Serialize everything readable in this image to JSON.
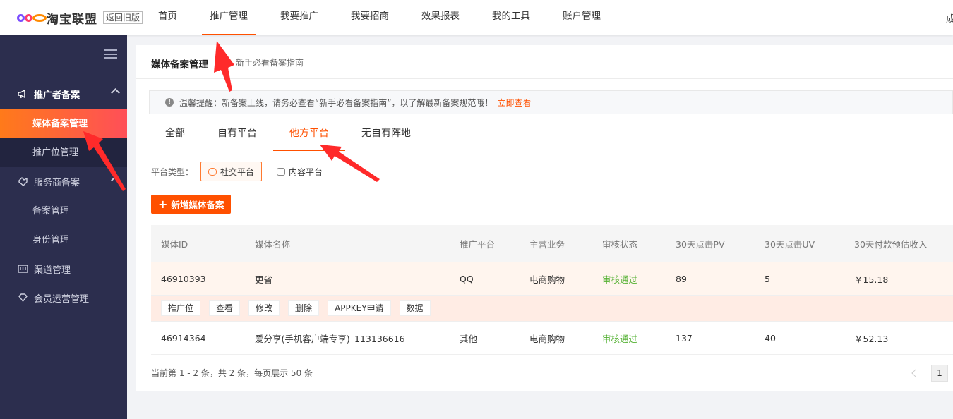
{
  "brand": {
    "name": "淘宝联盟",
    "old_version": "返回旧版"
  },
  "nav": {
    "items": [
      "首页",
      "推广管理",
      "我要推广",
      "我要招商",
      "效果报表",
      "我的工具",
      "账户管理"
    ],
    "active": "推广管理",
    "user": "成"
  },
  "sidebar": {
    "group1": "推广者备案",
    "group1_items": [
      "媒体备案管理",
      "推广位管理"
    ],
    "group2": "服务商备案",
    "group2_items": [
      "备案管理",
      "身份管理"
    ],
    "group3": "渠道管理",
    "group4": "会员运营管理"
  },
  "page": {
    "title": "媒体备案管理",
    "guide": "新手必看备案指南",
    "notice": "温馨提醒：新备案上线，请务必查看“新手必看备案指南”，以了解最新备案规范哦！",
    "notice_link": "立即查看",
    "tabs": [
      "全部",
      "自有平台",
      "他方平台",
      "无自有阵地"
    ],
    "active_tab": "他方平台",
    "platform_type_label": "平台类型：",
    "platform_types": [
      "社交平台",
      "内容平台"
    ],
    "add_button": "新增媒体备案",
    "footer": "当前第 1 - 2 条，共 2 条，每页展示 50 条",
    "page_number": "1"
  },
  "table": {
    "headers": [
      "媒体ID",
      "媒体名称",
      "推广平台",
      "主营业务",
      "审核状态",
      "30天点击PV",
      "30天点击UV",
      "30天付款预估收入"
    ],
    "rows": [
      [
        "46910393",
        "更省",
        "QQ",
        "电商购物",
        "审核通过",
        "89",
        "5",
        "￥15.18"
      ],
      [
        "46914364",
        "爱分享(手机客户端专享)_113136616",
        "其他",
        "电商购物",
        "审核通过",
        "137",
        "40",
        "￥52.13"
      ]
    ],
    "actions": [
      "推广位",
      "查看",
      "修改",
      "删除",
      "APPKEY申请",
      "数据"
    ]
  },
  "colors": {
    "accent": "#ff5000",
    "sidebar": "#2c2e4e",
    "pass": "#52b030",
    "arrow": "#ff3333"
  }
}
